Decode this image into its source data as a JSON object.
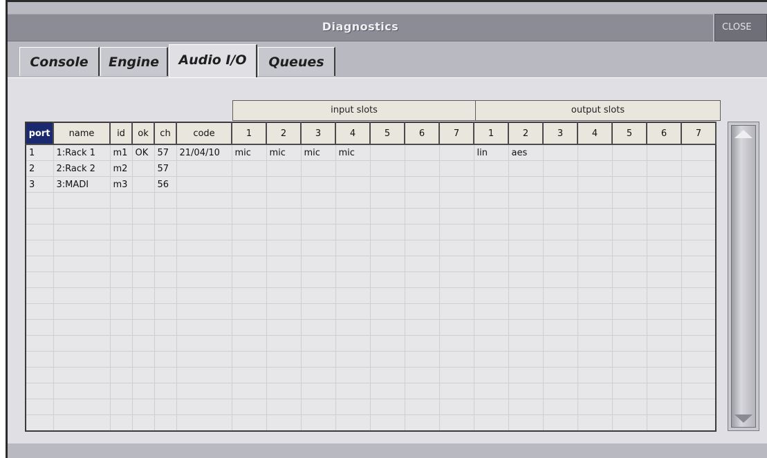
{
  "window": {
    "title": "Diagnostics",
    "close_label": "CLOSE"
  },
  "tabs": [
    {
      "label": "Console",
      "active": false
    },
    {
      "label": "Engine",
      "active": false
    },
    {
      "label": "Audio I/O",
      "active": true
    },
    {
      "label": "Queues",
      "active": false
    }
  ],
  "groups": {
    "input_label": "input slots",
    "output_label": "output slots"
  },
  "columns": [
    "port",
    "name",
    "id",
    "ok",
    "ch",
    "code",
    "1",
    "2",
    "3",
    "4",
    "5",
    "6",
    "7",
    "1",
    "2",
    "3",
    "4",
    "5",
    "6",
    "7"
  ],
  "selected_column": "port",
  "rows": [
    [
      "1",
      "1:Rack 1",
      "m1",
      "OK",
      "57",
      "21/04/10",
      "mic",
      "mic",
      "mic",
      "mic",
      "",
      "",
      "",
      "lin",
      "aes",
      "",
      "",
      "",
      "",
      ""
    ],
    [
      "2",
      "2:Rack 2",
      "m2",
      "",
      "57",
      "",
      "",
      "",
      "",
      "",
      "",
      "",
      "",
      "",
      "",
      "",
      "",
      "",
      "",
      ""
    ],
    [
      "3",
      "3:MADI",
      "m3",
      "",
      "56",
      "",
      "",
      "",
      "",
      "",
      "",
      "",
      "",
      "",
      "",
      "",
      "",
      "",
      "",
      ""
    ],
    [
      "",
      "",
      "",
      "",
      "",
      "",
      "",
      "",
      "",
      "",
      "",
      "",
      "",
      "",
      "",
      "",
      "",
      "",
      "",
      ""
    ],
    [
      "",
      "",
      "",
      "",
      "",
      "",
      "",
      "",
      "",
      "",
      "",
      "",
      "",
      "",
      "",
      "",
      "",
      "",
      "",
      ""
    ],
    [
      "",
      "",
      "",
      "",
      "",
      "",
      "",
      "",
      "",
      "",
      "",
      "",
      "",
      "",
      "",
      "",
      "",
      "",
      "",
      ""
    ],
    [
      "",
      "",
      "",
      "",
      "",
      "",
      "",
      "",
      "",
      "",
      "",
      "",
      "",
      "",
      "",
      "",
      "",
      "",
      "",
      ""
    ],
    [
      "",
      "",
      "",
      "",
      "",
      "",
      "",
      "",
      "",
      "",
      "",
      "",
      "",
      "",
      "",
      "",
      "",
      "",
      "",
      ""
    ],
    [
      "",
      "",
      "",
      "",
      "",
      "",
      "",
      "",
      "",
      "",
      "",
      "",
      "",
      "",
      "",
      "",
      "",
      "",
      "",
      ""
    ],
    [
      "",
      "",
      "",
      "",
      "",
      "",
      "",
      "",
      "",
      "",
      "",
      "",
      "",
      "",
      "",
      "",
      "",
      "",
      "",
      ""
    ],
    [
      "",
      "",
      "",
      "",
      "",
      "",
      "",
      "",
      "",
      "",
      "",
      "",
      "",
      "",
      "",
      "",
      "",
      "",
      "",
      ""
    ],
    [
      "",
      "",
      "",
      "",
      "",
      "",
      "",
      "",
      "",
      "",
      "",
      "",
      "",
      "",
      "",
      "",
      "",
      "",
      "",
      ""
    ],
    [
      "",
      "",
      "",
      "",
      "",
      "",
      "",
      "",
      "",
      "",
      "",
      "",
      "",
      "",
      "",
      "",
      "",
      "",
      "",
      ""
    ],
    [
      "",
      "",
      "",
      "",
      "",
      "",
      "",
      "",
      "",
      "",
      "",
      "",
      "",
      "",
      "",
      "",
      "",
      "",
      "",
      ""
    ],
    [
      "",
      "",
      "",
      "",
      "",
      "",
      "",
      "",
      "",
      "",
      "",
      "",
      "",
      "",
      "",
      "",
      "",
      "",
      "",
      ""
    ],
    [
      "",
      "",
      "",
      "",
      "",
      "",
      "",
      "",
      "",
      "",
      "",
      "",
      "",
      "",
      "",
      "",
      "",
      "",
      "",
      ""
    ],
    [
      "",
      "",
      "",
      "",
      "",
      "",
      "",
      "",
      "",
      "",
      "",
      "",
      "",
      "",
      "",
      "",
      "",
      "",
      "",
      ""
    ],
    [
      "",
      "",
      "",
      "",
      "",
      "",
      "",
      "",
      "",
      "",
      "",
      "",
      "",
      "",
      "",
      "",
      "",
      "",
      "",
      ""
    ]
  ],
  "scrollbar": {
    "up_icon": "arrow-up-icon",
    "down_icon": "arrow-down-icon"
  }
}
